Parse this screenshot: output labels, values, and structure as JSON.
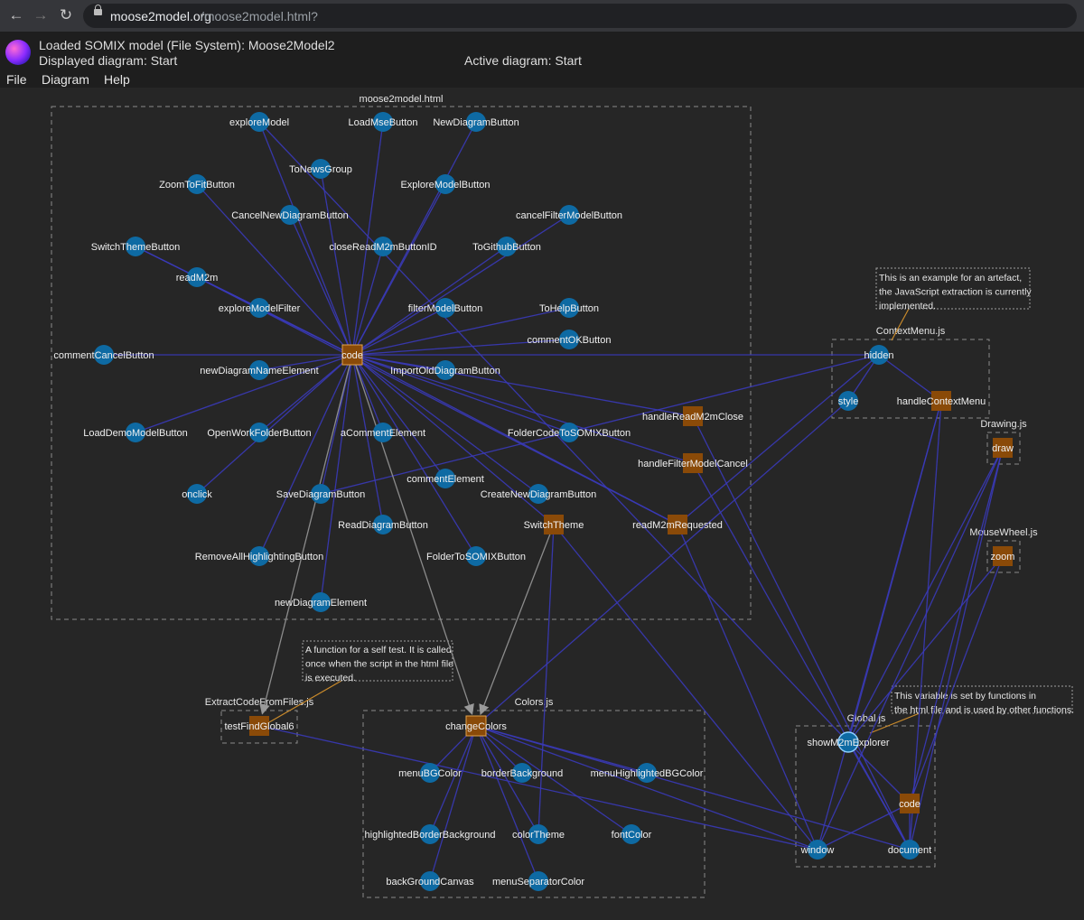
{
  "browser": {
    "url_host": "moose2model.org",
    "url_path": "/moose2model.html?"
  },
  "header": {
    "loaded_model": "Loaded SOMIX model (File System): Moose2Model2",
    "displayed_diagram": "Displayed diagram: Start",
    "active_diagram": "Active diagram: Start"
  },
  "menu": [
    "File",
    "Diagram",
    "Help"
  ],
  "colors": {
    "background": "#262626",
    "node_blue": "#0e6aa3",
    "node_orange": "#8a4a08",
    "edge_blue": "#3a3ab8",
    "edge_gray": "#8c8c8c",
    "note_line": "#c98a2b"
  },
  "diagram": {
    "groups": [
      {
        "id": "g_html",
        "label": "moose2model.html"
      },
      {
        "id": "g_ctx",
        "label": "ContextMenu.js"
      },
      {
        "id": "g_draw",
        "label": "Drawing.js"
      },
      {
        "id": "g_mouse",
        "label": "MouseWheel.js"
      },
      {
        "id": "g_extract",
        "label": "ExtractCodeFromFiles.js"
      },
      {
        "id": "g_colors",
        "label": "Colors.js"
      },
      {
        "id": "g_global",
        "label": "Global.js"
      }
    ],
    "notes": [
      {
        "id": "note_ctx",
        "lines": [
          "This is an example for an artefact,",
          "the JavaScript extraction is currently",
          "implemented."
        ]
      },
      {
        "id": "note_selftest",
        "lines": [
          "A function for a self test. It is called",
          "once when the script in the html file",
          "is executed."
        ]
      },
      {
        "id": "note_global",
        "lines": [
          "This variable is set by functions in",
          "the html file and is used by other functions."
        ]
      }
    ],
    "nodes": [
      {
        "id": "exploreModel",
        "label": "exploreModel",
        "kind": "circle"
      },
      {
        "id": "LoadMseButton",
        "label": "LoadMseButton",
        "kind": "circle"
      },
      {
        "id": "NewDiagramButton",
        "label": "NewDiagramButton",
        "kind": "circle"
      },
      {
        "id": "ToNewsGroup",
        "label": "ToNewsGroup",
        "kind": "circle"
      },
      {
        "id": "ZoomToFitButton",
        "label": "ZoomToFitButton",
        "kind": "circle"
      },
      {
        "id": "ExploreModelButton",
        "label": "ExploreModelButton",
        "kind": "circle"
      },
      {
        "id": "CancelNewDiagramButton",
        "label": "CancelNewDiagramButton",
        "kind": "circle"
      },
      {
        "id": "cancelFilterModelButton",
        "label": "cancelFilterModelButton",
        "kind": "circle"
      },
      {
        "id": "SwitchThemeButton",
        "label": "SwitchThemeButton",
        "kind": "circle"
      },
      {
        "id": "closeReadM2mButtonID",
        "label": "closeReadM2mButtonID",
        "kind": "circle"
      },
      {
        "id": "ToGithubButton",
        "label": "ToGithubButton",
        "kind": "circle"
      },
      {
        "id": "readM2m",
        "label": "readM2m",
        "kind": "circle"
      },
      {
        "id": "exploreModelFilter",
        "label": "exploreModelFilter",
        "kind": "circle"
      },
      {
        "id": "filterModelButton",
        "label": "filterModelButton",
        "kind": "circle"
      },
      {
        "id": "ToHelpButton",
        "label": "ToHelpButton",
        "kind": "circle"
      },
      {
        "id": "commentOKButton",
        "label": "commentOKButton",
        "kind": "circle"
      },
      {
        "id": "commentCancelButton",
        "label": "commentCancelButton",
        "kind": "circle"
      },
      {
        "id": "code_html",
        "label": "code",
        "kind": "square"
      },
      {
        "id": "newDiagramNameElement",
        "label": "newDiagramNameElement",
        "kind": "circle"
      },
      {
        "id": "ImportOldDiagramButton",
        "label": "ImportOldDiagramButton",
        "kind": "circle"
      },
      {
        "id": "handleReadM2mClose",
        "label": "handleReadM2mClose",
        "kind": "square"
      },
      {
        "id": "LoadDemoModelButton",
        "label": "LoadDemoModelButton",
        "kind": "circle"
      },
      {
        "id": "OpenWorkFolderButton",
        "label": "OpenWorkFolderButton",
        "kind": "circle"
      },
      {
        "id": "aCommentElement",
        "label": "aCommentElement",
        "kind": "circle"
      },
      {
        "id": "FolderCodeToSOMIXButton",
        "label": "FolderCodeToSOMIXButton",
        "kind": "circle"
      },
      {
        "id": "handleFilterModelCancel",
        "label": "handleFilterModelCancel",
        "kind": "square"
      },
      {
        "id": "commentElement",
        "label": "commentElement",
        "kind": "circle"
      },
      {
        "id": "onclick",
        "label": "onclick",
        "kind": "circle"
      },
      {
        "id": "SaveDiagramButton",
        "label": "SaveDiagramButton",
        "kind": "circle"
      },
      {
        "id": "CreateNewDiagramButton",
        "label": "CreateNewDiagramButton",
        "kind": "circle"
      },
      {
        "id": "ReadDiagramButton",
        "label": "ReadDiagramButton",
        "kind": "circle"
      },
      {
        "id": "SwitchTheme",
        "label": "SwitchTheme",
        "kind": "square"
      },
      {
        "id": "readM2mRequested",
        "label": "readM2mRequested",
        "kind": "square"
      },
      {
        "id": "RemoveAllHighlightingButton",
        "label": "RemoveAllHighlightingButton",
        "kind": "circle"
      },
      {
        "id": "FolderToSOMIXButton",
        "label": "FolderToSOMIXButton",
        "kind": "circle"
      },
      {
        "id": "newDiagramElement",
        "label": "newDiagramElement",
        "kind": "circle"
      },
      {
        "id": "hidden",
        "label": "hidden",
        "kind": "circle"
      },
      {
        "id": "style",
        "label": "style",
        "kind": "circle"
      },
      {
        "id": "handleContextMenu",
        "label": "handleContextMenu",
        "kind": "square"
      },
      {
        "id": "draw",
        "label": "draw",
        "kind": "square"
      },
      {
        "id": "zoom",
        "label": "zoom",
        "kind": "square"
      },
      {
        "id": "testFindGlobal6",
        "label": "testFindGlobal6",
        "kind": "square"
      },
      {
        "id": "changeColors",
        "label": "changeColors",
        "kind": "square"
      },
      {
        "id": "menuBGColor",
        "label": "menuBGColor",
        "kind": "circle"
      },
      {
        "id": "borderBackground",
        "label": "borderBackground",
        "kind": "circle"
      },
      {
        "id": "menuHighlightedBGColor",
        "label": "menuHighlightedBGColor",
        "kind": "circle"
      },
      {
        "id": "highlightedBorderBackground",
        "label": "highlightedBorderBackground",
        "kind": "circle"
      },
      {
        "id": "colorTheme",
        "label": "colorTheme",
        "kind": "circle"
      },
      {
        "id": "fontColor",
        "label": "fontColor",
        "kind": "circle"
      },
      {
        "id": "backGroundCanvas",
        "label": "backGroundCanvas",
        "kind": "circle"
      },
      {
        "id": "menuSeparatorColor",
        "label": "menuSeparatorColor",
        "kind": "circle"
      },
      {
        "id": "showM2mExplorer",
        "label": "showM2mExplorer",
        "kind": "circle"
      },
      {
        "id": "code_global",
        "label": "code",
        "kind": "square"
      },
      {
        "id": "window",
        "label": "window",
        "kind": "circle"
      },
      {
        "id": "document",
        "label": "document",
        "kind": "circle"
      }
    ],
    "edges": [
      [
        "code_html",
        "exploreModel"
      ],
      [
        "code_html",
        "LoadMseButton"
      ],
      [
        "code_html",
        "NewDiagramButton"
      ],
      [
        "code_html",
        "ToNewsGroup"
      ],
      [
        "code_html",
        "ZoomToFitButton"
      ],
      [
        "code_html",
        "ExploreModelButton"
      ],
      [
        "code_html",
        "CancelNewDiagramButton"
      ],
      [
        "code_html",
        "cancelFilterModelButton"
      ],
      [
        "code_html",
        "SwitchThemeButton"
      ],
      [
        "code_html",
        "closeReadM2mButtonID"
      ],
      [
        "code_html",
        "ToGithubButton"
      ],
      [
        "code_html",
        "readM2m"
      ],
      [
        "code_html",
        "exploreModelFilter"
      ],
      [
        "code_html",
        "filterModelButton"
      ],
      [
        "code_html",
        "ToHelpButton"
      ],
      [
        "code_html",
        "commentOKButton"
      ],
      [
        "code_html",
        "commentCancelButton"
      ],
      [
        "code_html",
        "newDiagramNameElement"
      ],
      [
        "code_html",
        "ImportOldDiagramButton"
      ],
      [
        "code_html",
        "handleReadM2mClose"
      ],
      [
        "code_html",
        "LoadDemoModelButton"
      ],
      [
        "code_html",
        "OpenWorkFolderButton"
      ],
      [
        "code_html",
        "aCommentElement"
      ],
      [
        "code_html",
        "FolderCodeToSOMIXButton"
      ],
      [
        "code_html",
        "handleFilterModelCancel"
      ],
      [
        "code_html",
        "commentElement"
      ],
      [
        "code_html",
        "onclick"
      ],
      [
        "code_html",
        "SaveDiagramButton"
      ],
      [
        "code_html",
        "CreateNewDiagramButton"
      ],
      [
        "code_html",
        "ReadDiagramButton"
      ],
      [
        "code_html",
        "SwitchTheme"
      ],
      [
        "code_html",
        "readM2mRequested"
      ],
      [
        "code_html",
        "RemoveAllHighlightingButton"
      ],
      [
        "code_html",
        "FolderToSOMIXButton"
      ],
      [
        "code_html",
        "newDiagramElement"
      ],
      [
        "code_html",
        "hidden"
      ],
      [
        "readM2m",
        "exploreModelFilter"
      ],
      [
        "SwitchThemeButton",
        "exploreModelFilter"
      ],
      [
        "exploreModel",
        "showM2mExplorer"
      ],
      [
        "readM2m",
        "readM2mRequested"
      ],
      [
        "handleReadM2mClose",
        "document"
      ],
      [
        "handleFilterModelCancel",
        "document"
      ],
      [
        "readM2mRequested",
        "window"
      ],
      [
        "SwitchTheme",
        "colorTheme"
      ],
      [
        "SwitchTheme",
        "window"
      ],
      [
        "hidden",
        "handleContextMenu"
      ],
      [
        "hidden",
        "style"
      ],
      [
        "hidden",
        "SaveDiagramButton"
      ],
      [
        "style",
        "changeColors"
      ],
      [
        "handleContextMenu",
        "window"
      ],
      [
        "handleContextMenu",
        "document"
      ],
      [
        "handleContextMenu",
        "showM2mExplorer"
      ],
      [
        "draw",
        "showM2mExplorer"
      ],
      [
        "draw",
        "window"
      ],
      [
        "draw",
        "document"
      ],
      [
        "draw",
        "code_global"
      ],
      [
        "zoom",
        "showM2mExplorer"
      ],
      [
        "zoom",
        "code_global"
      ],
      [
        "hidden",
        "readM2mRequested"
      ],
      [
        "changeColors",
        "menuBGColor"
      ],
      [
        "changeColors",
        "borderBackground"
      ],
      [
        "changeColors",
        "menuHighlightedBGColor"
      ],
      [
        "changeColors",
        "highlightedBorderBackground"
      ],
      [
        "changeColors",
        "colorTheme"
      ],
      [
        "changeColors",
        "fontColor"
      ],
      [
        "changeColors",
        "backGroundCanvas"
      ],
      [
        "changeColors",
        "menuSeparatorColor"
      ],
      [
        "changeColors",
        "window"
      ],
      [
        "changeColors",
        "document"
      ],
      [
        "testFindGlobal6",
        "window"
      ],
      [
        "showM2mExplorer",
        "code_global"
      ],
      [
        "showM2mExplorer",
        "document"
      ],
      [
        "code_global",
        "window"
      ],
      [
        "code_global",
        "document"
      ]
    ],
    "gray_edges": [
      [
        "code_html",
        "testFindGlobal6"
      ],
      [
        "code_html",
        "changeColors"
      ],
      [
        "SwitchTheme",
        "changeColors"
      ]
    ]
  }
}
